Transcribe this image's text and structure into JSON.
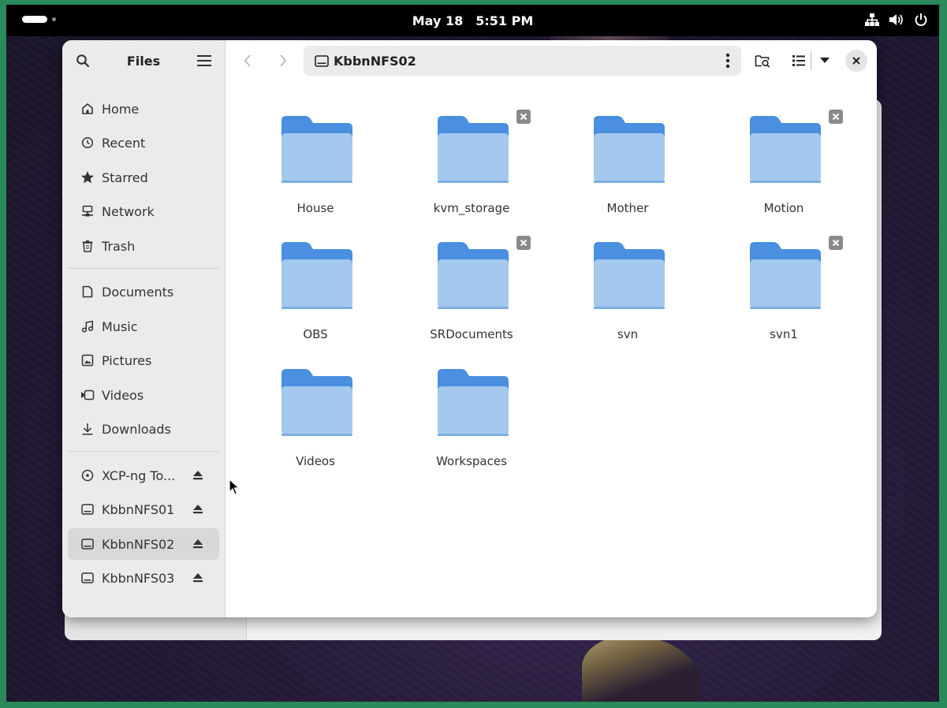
{
  "topbar": {
    "date": "May 18",
    "time": "5:51 PM",
    "icons": [
      "network-icon",
      "volume-icon",
      "power-icon"
    ]
  },
  "sidebar": {
    "title": "Files",
    "places": [
      {
        "label": "Home",
        "icon": "home-icon"
      },
      {
        "label": "Recent",
        "icon": "recent-icon"
      },
      {
        "label": "Starred",
        "icon": "star-icon"
      },
      {
        "label": "Network",
        "icon": "network-icon"
      },
      {
        "label": "Trash",
        "icon": "trash-icon"
      }
    ],
    "bookmarks": [
      {
        "label": "Documents",
        "icon": "document-icon"
      },
      {
        "label": "Music",
        "icon": "music-icon"
      },
      {
        "label": "Pictures",
        "icon": "picture-icon"
      },
      {
        "label": "Videos",
        "icon": "video-icon"
      },
      {
        "label": "Downloads",
        "icon": "download-icon"
      }
    ],
    "devices": [
      {
        "label": "XCP-ng To...",
        "icon": "disc-icon"
      },
      {
        "label": "KbbnNFS01",
        "icon": "drive-icon"
      },
      {
        "label": "KbbnNFS02",
        "icon": "drive-icon",
        "selected": true
      },
      {
        "label": "KbbnNFS03",
        "icon": "drive-icon"
      }
    ]
  },
  "pathbar": {
    "location": "KbbnNFS02"
  },
  "files": [
    {
      "name": "House",
      "shared": false
    },
    {
      "name": "kvm_storage",
      "shared": true
    },
    {
      "name": "Mother",
      "shared": false
    },
    {
      "name": "Motion",
      "shared": true
    },
    {
      "name": "OBS",
      "shared": false
    },
    {
      "name": "SRDocuments",
      "shared": true
    },
    {
      "name": "svn",
      "shared": false
    },
    {
      "name": "svn1",
      "shared": true
    },
    {
      "name": "Videos",
      "shared": false
    },
    {
      "name": "Workspaces",
      "shared": false
    }
  ],
  "colors": {
    "folder_front": "#a4c8ee",
    "folder_back": "#4a8fe0",
    "accent_border": "#2a8a5a"
  }
}
